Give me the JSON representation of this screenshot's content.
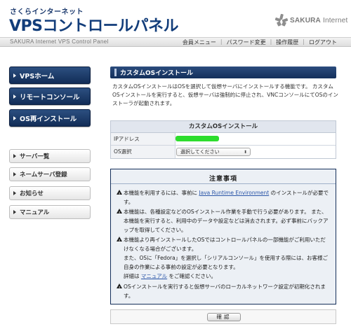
{
  "header": {
    "brand_small": "さくらインターネット",
    "brand_big": "VPSコントロールパネル",
    "logo_text_bold": "SAKURA",
    "logo_text_thin": " Internet",
    "subtitle": "SAKURA Internet VPS Control Panel",
    "menu": [
      {
        "label": "会員メニュー"
      },
      {
        "label": "パスワード変更"
      },
      {
        "label": "操作履歴"
      },
      {
        "label": "ログアウト"
      }
    ]
  },
  "sidebar": {
    "primary": [
      {
        "label": "VPSホーム"
      },
      {
        "label": "リモートコンソール"
      },
      {
        "label": "OS再インストール"
      }
    ],
    "secondary": [
      {
        "label": "サーバ一覧"
      },
      {
        "label": "ネームサーバ登録"
      },
      {
        "label": "お知らせ"
      },
      {
        "label": "マニュアル"
      }
    ]
  },
  "main": {
    "title": "カスタムOSインストール",
    "intro": "カスタムOSインストールはOSを選択して仮想サーバにインストールする機能です。 カスタムOSインストールを実行すると、仮想サーバは強制的に停止され、VNCコンソールにてOSのインストーラが起動されます。",
    "table": {
      "header": "カスタムOSインストール",
      "ip_label": "IPアドレス",
      "os_label": "OS選択",
      "os_select_value": "選択してください"
    },
    "notice": {
      "title": "注意事項",
      "item1_pre": "本機能を利用するには、事前に ",
      "item1_link": "Java Runtime Environment",
      "item1_post": " のインストールが必要です。",
      "item2": "本機能は、各種設定などのOSインストール作業を手動で行う必要があります。 また、本機能を実行すると、利用中のデータや設定などは消去されます。必ず事前にバックアップを取得してください。",
      "item3_a": "本機能より再インストールしたOSではコントロールパネルの一部機能がご利用いただけなくなる場合がございます。",
      "item3_b": "また、OSに「Fedora」を選択し「シリアルコンソール」を使用する際には、お客様ご自身の作業による事前の設定が必要となります。",
      "item3_c_pre": "詳細は ",
      "item3_c_link": "マニュアル",
      "item3_c_post": " をご確認ください。",
      "item4": "OSインストールを実行すると仮想サーバのローカルネットワーク設定が初期化されます。"
    },
    "confirm_label": "確認"
  },
  "colors": {
    "navy": "#132f5b",
    "ip_redaction": "#2ddd2d",
    "link": "#2a55a8"
  }
}
